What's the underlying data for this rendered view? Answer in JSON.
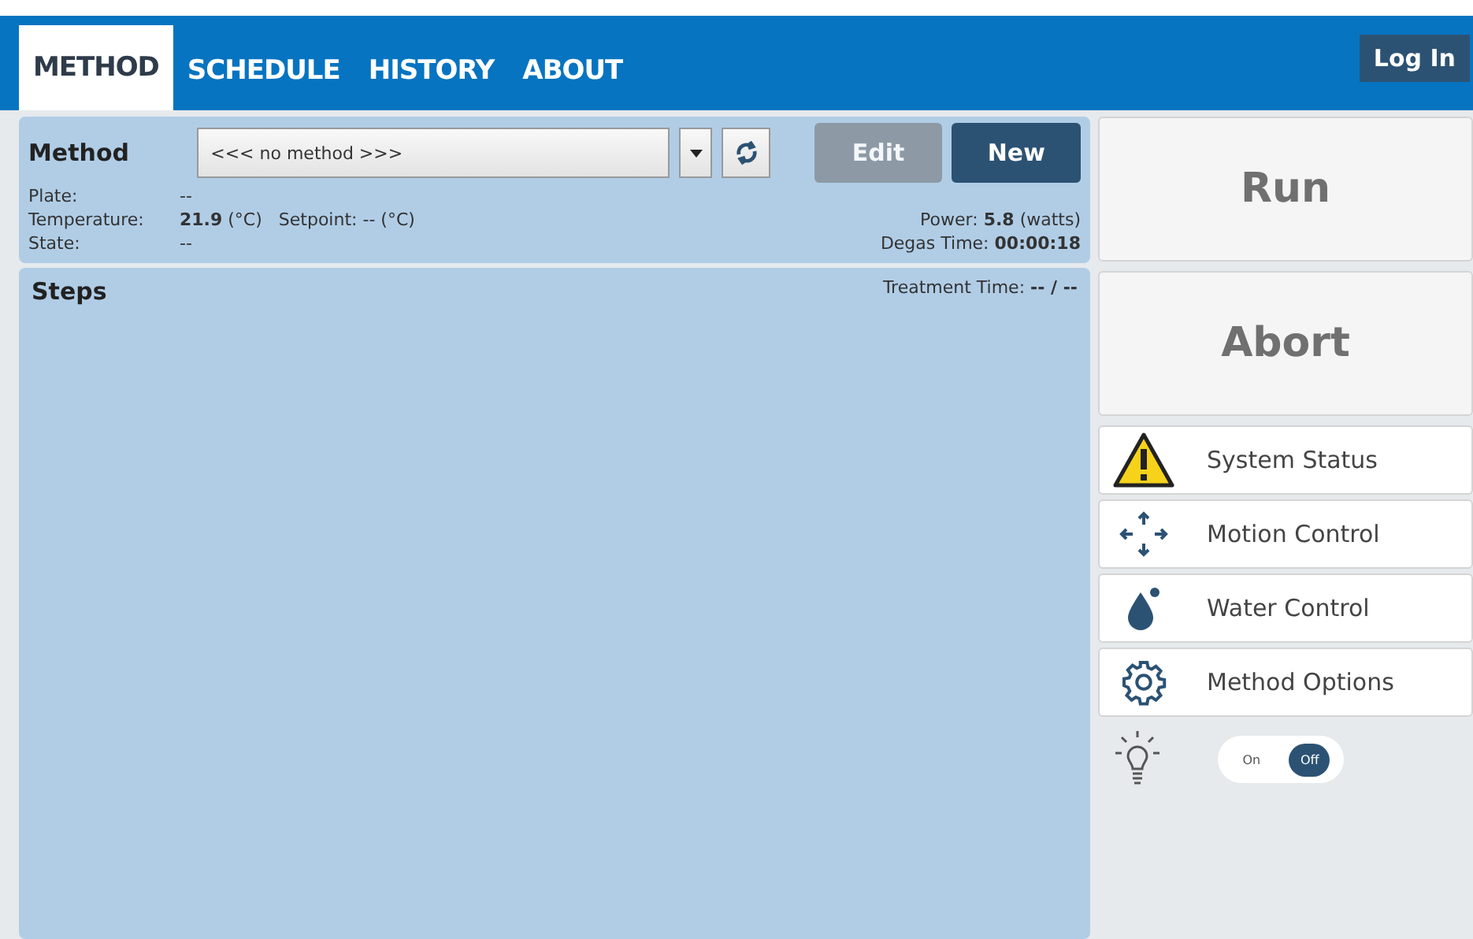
{
  "tabs": [
    {
      "label": "METHOD",
      "selected": true
    },
    {
      "label": "SCHEDULE",
      "selected": false
    },
    {
      "label": "HISTORY",
      "selected": false
    },
    {
      "label": "ABOUT",
      "selected": false
    }
  ],
  "login": "Log In",
  "method": {
    "label": "Method",
    "select_value": "<<< no method >>>",
    "buttons": [
      {
        "label": "Edit",
        "disabled": true
      },
      {
        "label": "New",
        "disabled": false
      }
    ],
    "plate": {
      "label": "Plate:",
      "value": "--"
    },
    "temperature": {
      "label": "Temperature:",
      "value": "21.9",
      "unit": "(°C)"
    },
    "setpoint": {
      "label": "Setpoint:",
      "value": "-- (°C)"
    },
    "state": {
      "label": "State:",
      "value": "--"
    },
    "power": {
      "label": "Power:",
      "value": "5.8",
      "unit": "(watts)"
    },
    "degas": {
      "label": "Degas Time:",
      "value": "00:00:18"
    }
  },
  "steps": {
    "title": "Steps",
    "treatment_label": "Treatment Time:",
    "treatment_value": "-- / --"
  },
  "actions": [
    {
      "label": "Run"
    },
    {
      "label": "Abort"
    }
  ],
  "menu": [
    {
      "kind": "warning",
      "label": "System Status"
    },
    {
      "kind": "motion",
      "label": "Motion Control"
    },
    {
      "kind": "water",
      "label": "Water Control"
    },
    {
      "kind": "gear",
      "label": "Method Options"
    }
  ],
  "light_toggle": [
    {
      "label": "On",
      "selected": false
    },
    {
      "label": "Off",
      "selected": true
    }
  ]
}
